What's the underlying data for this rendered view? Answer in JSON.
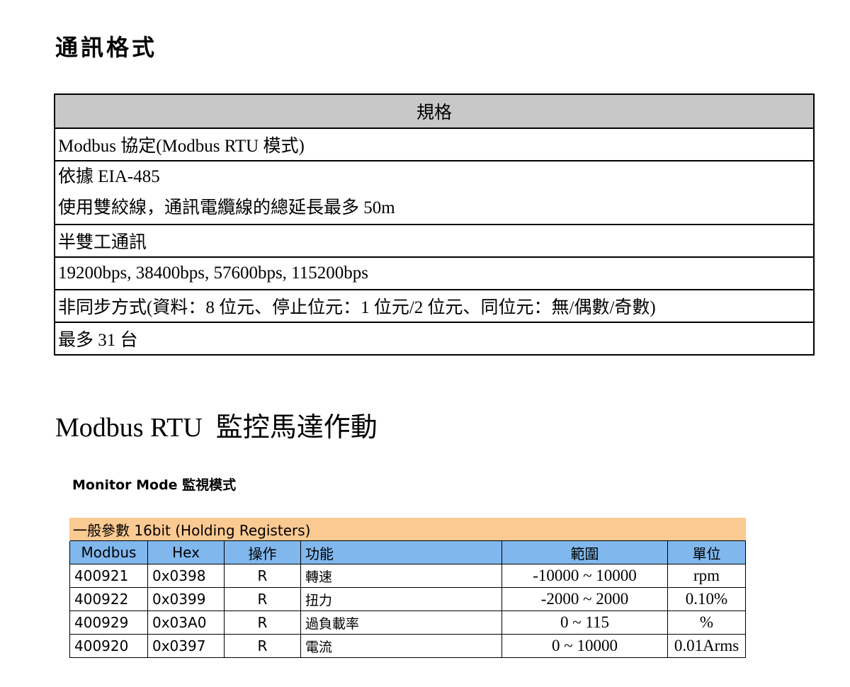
{
  "comm_heading": "通訊格式",
  "spec_table": {
    "header": "規格",
    "rows": [
      [
        "Modbus 協定(Modbus RTU 模式)"
      ],
      [
        "依據 EIA-485",
        "使用雙絞線，通訊電纜線的總延長最多 50m"
      ],
      [
        "半雙工通訊"
      ],
      [
        "19200bps, 38400bps, 57600bps, 115200bps"
      ],
      [
        "非同步方式(資料：8 位元、停止位元：1 位元/2 位元、同位元：無/偶數/奇數)"
      ],
      [
        "最多 31 台"
      ]
    ]
  },
  "rtu_heading": "Modbus RTU  監控馬達作動",
  "monitor_heading": "Monitor Mode 監視模式",
  "register_table": {
    "group_label": "一般參數 16bit (Holding Registers)",
    "columns": [
      "Modbus",
      "Hex",
      "操作",
      "功能",
      "範圍",
      "單位"
    ],
    "rows": [
      [
        "400921",
        "0x0398",
        "R",
        "轉速",
        "-10000 ~ 10000",
        "rpm"
      ],
      [
        "400922",
        "0x0399",
        "R",
        "扭力",
        "-2000 ~ 2000",
        "0.10%"
      ],
      [
        "400929",
        "0x03A0",
        "R",
        "過負載率",
        "0 ~ 115",
        "%"
      ],
      [
        "400920",
        "0x0397",
        "R",
        "電流",
        "0 ~ 10000",
        "0.01Arms"
      ]
    ]
  },
  "colors": {
    "spec_header_bg": "#c8c8c8",
    "group_bg": "#fbc992",
    "column_header_bg": "#80b7ed"
  }
}
